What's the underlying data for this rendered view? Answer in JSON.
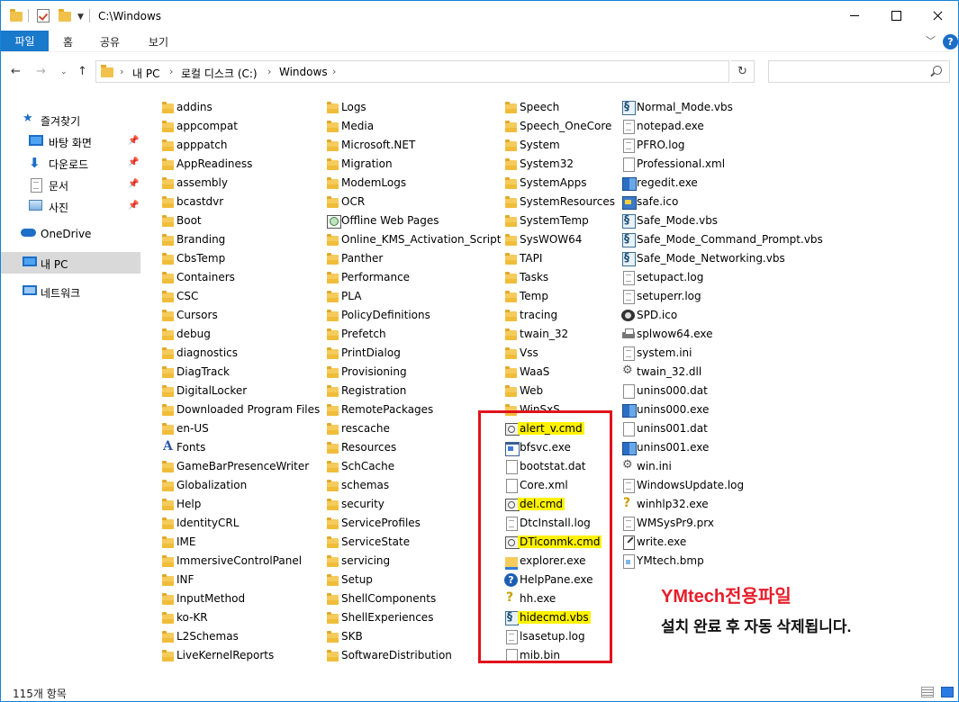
{
  "window": {
    "title": "C:\\Windows"
  },
  "ribbon": {
    "tabs": [
      "파일",
      "홈",
      "공유",
      "보기"
    ]
  },
  "address": {
    "crumbs": [
      "내 PC",
      "로컬 디스크 (C:)",
      "Windows"
    ],
    "search_placeholder": ""
  },
  "nav": {
    "quick_access": "즐겨찾기",
    "pinned": [
      "바탕 화면",
      "다운로드",
      "문서",
      "사진"
    ],
    "onedrive": "OneDrive",
    "thispc": "내 PC",
    "network": "네트워크"
  },
  "columns": [
    [
      {
        "name": "addins",
        "icon": "folder"
      },
      {
        "name": "appcompat",
        "icon": "folder"
      },
      {
        "name": "apppatch",
        "icon": "folder"
      },
      {
        "name": "AppReadiness",
        "icon": "folder"
      },
      {
        "name": "assembly",
        "icon": "folder"
      },
      {
        "name": "bcastdvr",
        "icon": "folder"
      },
      {
        "name": "Boot",
        "icon": "folder"
      },
      {
        "name": "Branding",
        "icon": "folder"
      },
      {
        "name": "CbsTemp",
        "icon": "folder"
      },
      {
        "name": "Containers",
        "icon": "folder"
      },
      {
        "name": "CSC",
        "icon": "folder"
      },
      {
        "name": "Cursors",
        "icon": "folder"
      },
      {
        "name": "debug",
        "icon": "folder"
      },
      {
        "name": "diagnostics",
        "icon": "folder"
      },
      {
        "name": "DiagTrack",
        "icon": "folder"
      },
      {
        "name": "DigitalLocker",
        "icon": "folder"
      },
      {
        "name": "Downloaded Program Files",
        "icon": "folder"
      },
      {
        "name": "en-US",
        "icon": "folder"
      },
      {
        "name": "Fonts",
        "icon": "font"
      },
      {
        "name": "GameBarPresenceWriter",
        "icon": "folder"
      },
      {
        "name": "Globalization",
        "icon": "folder"
      },
      {
        "name": "Help",
        "icon": "folder"
      },
      {
        "name": "IdentityCRL",
        "icon": "folder"
      },
      {
        "name": "IME",
        "icon": "folder"
      },
      {
        "name": "ImmersiveControlPanel",
        "icon": "folder"
      },
      {
        "name": "INF",
        "icon": "folder"
      },
      {
        "name": "InputMethod",
        "icon": "folder"
      },
      {
        "name": "ko-KR",
        "icon": "folder"
      },
      {
        "name": "L2Schemas",
        "icon": "folder"
      },
      {
        "name": "LiveKernelReports",
        "icon": "folder"
      }
    ],
    [
      {
        "name": "Logs",
        "icon": "folder"
      },
      {
        "name": "Media",
        "icon": "folder"
      },
      {
        "name": "Microsoft.NET",
        "icon": "folder"
      },
      {
        "name": "Migration",
        "icon": "folder"
      },
      {
        "name": "ModemLogs",
        "icon": "folder"
      },
      {
        "name": "OCR",
        "icon": "folder"
      },
      {
        "name": "Offline Web Pages",
        "icon": "web"
      },
      {
        "name": "Online_KMS_Activation_Script",
        "icon": "folder"
      },
      {
        "name": "Panther",
        "icon": "folder"
      },
      {
        "name": "Performance",
        "icon": "folder"
      },
      {
        "name": "PLA",
        "icon": "folder"
      },
      {
        "name": "PolicyDefinitions",
        "icon": "folder"
      },
      {
        "name": "Prefetch",
        "icon": "folder"
      },
      {
        "name": "PrintDialog",
        "icon": "folder"
      },
      {
        "name": "Provisioning",
        "icon": "folder"
      },
      {
        "name": "Registration",
        "icon": "folder"
      },
      {
        "name": "RemotePackages",
        "icon": "folder"
      },
      {
        "name": "rescache",
        "icon": "folder"
      },
      {
        "name": "Resources",
        "icon": "folder"
      },
      {
        "name": "SchCache",
        "icon": "folder"
      },
      {
        "name": "schemas",
        "icon": "folder"
      },
      {
        "name": "security",
        "icon": "folder"
      },
      {
        "name": "ServiceProfiles",
        "icon": "folder"
      },
      {
        "name": "ServiceState",
        "icon": "folder"
      },
      {
        "name": "servicing",
        "icon": "folder"
      },
      {
        "name": "Setup",
        "icon": "folder"
      },
      {
        "name": "ShellComponents",
        "icon": "folder"
      },
      {
        "name": "ShellExperiences",
        "icon": "folder"
      },
      {
        "name": "SKB",
        "icon": "folder"
      },
      {
        "name": "SoftwareDistribution",
        "icon": "folder"
      }
    ],
    [
      {
        "name": "Speech",
        "icon": "folder"
      },
      {
        "name": "Speech_OneCore",
        "icon": "folder"
      },
      {
        "name": "System",
        "icon": "folder"
      },
      {
        "name": "System32",
        "icon": "folder"
      },
      {
        "name": "SystemApps",
        "icon": "folder"
      },
      {
        "name": "SystemResources",
        "icon": "folder"
      },
      {
        "name": "SystemTemp",
        "icon": "folder"
      },
      {
        "name": "SysWOW64",
        "icon": "folder"
      },
      {
        "name": "TAPI",
        "icon": "folder"
      },
      {
        "name": "Tasks",
        "icon": "folder"
      },
      {
        "name": "Temp",
        "icon": "folder"
      },
      {
        "name": "tracing",
        "icon": "folder"
      },
      {
        "name": "twain_32",
        "icon": "folder"
      },
      {
        "name": "Vss",
        "icon": "folder"
      },
      {
        "name": "WaaS",
        "icon": "folder"
      },
      {
        "name": "Web",
        "icon": "folder"
      },
      {
        "name": "WinSxS",
        "icon": "folder"
      },
      {
        "name": "alert_v.cmd",
        "icon": "cmd",
        "highlight": true
      },
      {
        "name": "bfsvc.exe",
        "icon": "exe"
      },
      {
        "name": "bootstat.dat",
        "icon": "dat"
      },
      {
        "name": "Core.xml",
        "icon": "plain"
      },
      {
        "name": "del.cmd",
        "icon": "cmd",
        "highlight": true
      },
      {
        "name": "DtcInstall.log",
        "icon": "doc"
      },
      {
        "name": "DTiconmk.cmd",
        "icon": "cmd",
        "highlight": true
      },
      {
        "name": "explorer.exe",
        "icon": "explorer"
      },
      {
        "name": "HelpPane.exe",
        "icon": "help"
      },
      {
        "name": "hh.exe",
        "icon": "qhelp"
      },
      {
        "name": "hidecmd.vbs",
        "icon": "vbs",
        "highlight": true
      },
      {
        "name": "lsasetup.log",
        "icon": "doc"
      },
      {
        "name": "mib.bin",
        "icon": "plain"
      }
    ],
    [
      {
        "name": "Normal_Mode.vbs",
        "icon": "vbs"
      },
      {
        "name": "notepad.exe",
        "icon": "doc"
      },
      {
        "name": "PFRO.log",
        "icon": "doc"
      },
      {
        "name": "Professional.xml",
        "icon": "plain"
      },
      {
        "name": "regedit.exe",
        "icon": "regedit"
      },
      {
        "name": "safe.ico",
        "icon": "ico-img"
      },
      {
        "name": "Safe_Mode.vbs",
        "icon": "vbs"
      },
      {
        "name": "Safe_Mode_Command_Prompt.vbs",
        "icon": "vbs"
      },
      {
        "name": "Safe_Mode_Networking.vbs",
        "icon": "vbs"
      },
      {
        "name": "setupact.log",
        "icon": "doc"
      },
      {
        "name": "setuperr.log",
        "icon": "doc"
      },
      {
        "name": "SPD.ico",
        "icon": "spd"
      },
      {
        "name": "splwow64.exe",
        "icon": "printer"
      },
      {
        "name": "system.ini",
        "icon": "doc"
      },
      {
        "name": "twain_32.dll",
        "icon": "gear"
      },
      {
        "name": "unins000.dat",
        "icon": "dat"
      },
      {
        "name": "unins000.exe",
        "icon": "regedit"
      },
      {
        "name": "unins001.dat",
        "icon": "dat"
      },
      {
        "name": "unins001.exe",
        "icon": "regedit"
      },
      {
        "name": "win.ini",
        "icon": "gear"
      },
      {
        "name": "WindowsUpdate.log",
        "icon": "doc"
      },
      {
        "name": "winhlp32.exe",
        "icon": "qhelp"
      },
      {
        "name": "WMSysPr9.prx",
        "icon": "doc"
      },
      {
        "name": "write.exe",
        "icon": "write"
      },
      {
        "name": "YMtech.bmp",
        "icon": "bmp"
      }
    ]
  ],
  "annotation": {
    "title": "YMtech전용파일",
    "body": "설치 완료 후 자동 삭제됩니다.",
    "title_color": "#e81d2a",
    "box_color": "#e0121b",
    "highlight_color": "#fff200"
  },
  "status": {
    "count": "115개 항목"
  }
}
